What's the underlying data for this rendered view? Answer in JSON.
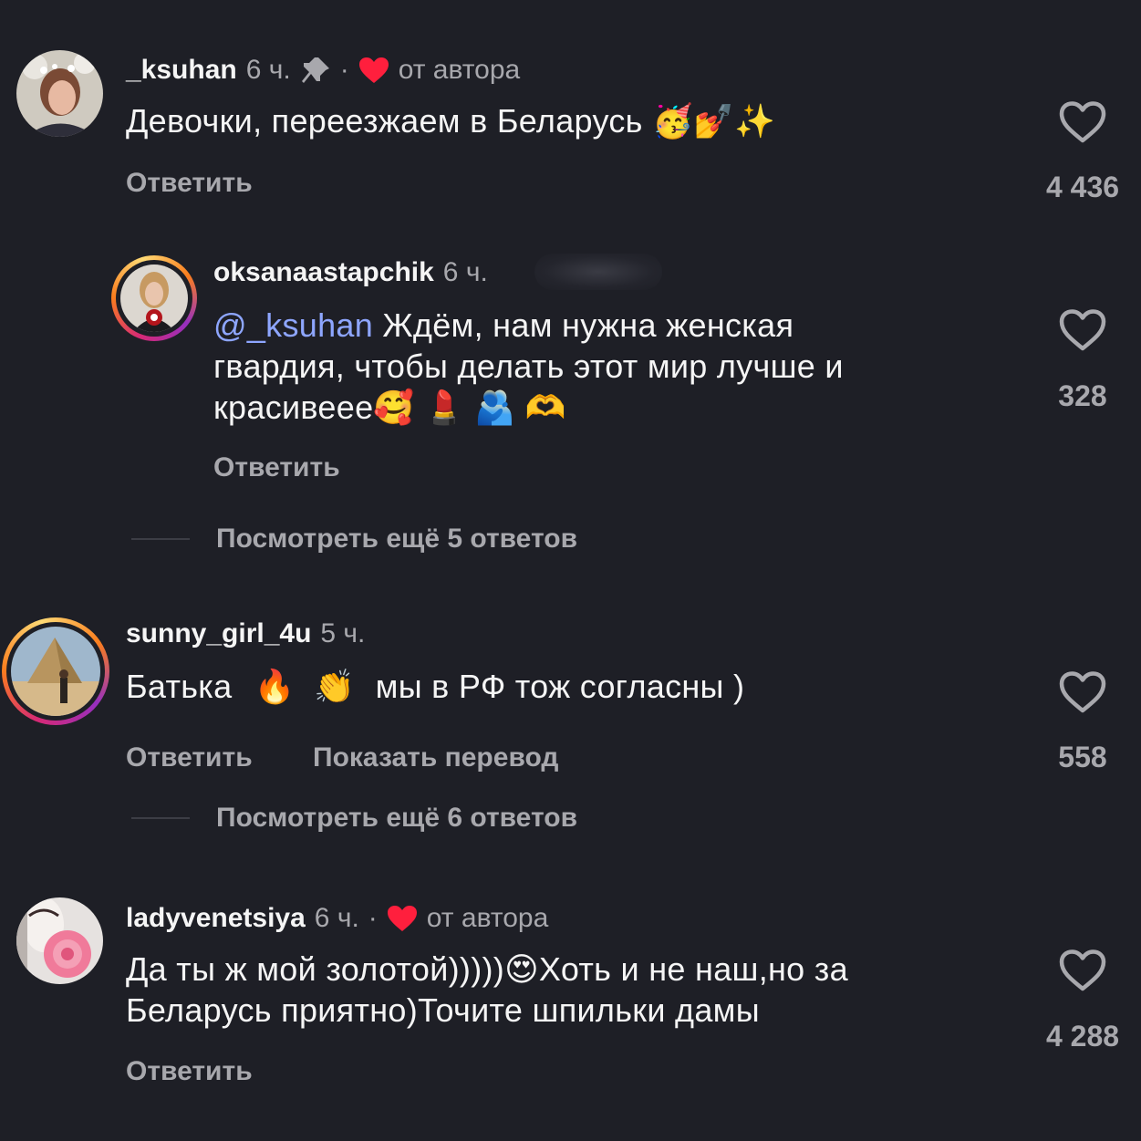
{
  "comments": [
    {
      "username": "_ksuhan",
      "time": "6 ч.",
      "dot": "·",
      "by_author": "от автора",
      "text": "Девочки, переезжаем в Беларусь",
      "emojis": "🥳💅✨",
      "reply": "Ответить",
      "likes": "4 436"
    },
    {
      "username": "oksanaastapchik",
      "time": "6 ч.",
      "mention": "@_ksuhan",
      "text_line1": " Ждём, нам нужна женская",
      "text_line2": "гвардия, чтобы делать этот мир лучше и",
      "text_line3": "красивеее",
      "emojis": "🥰 💄 🫂 🫶",
      "reply": "Ответить",
      "likes": "328",
      "more_replies": "Посмотреть ещё 5 ответов"
    },
    {
      "username": "sunny_girl_4u",
      "time": "5 ч.",
      "text_a": "Батька",
      "emoji_a": "🔥",
      "emoji_b": "👏",
      "text_b": "мы в РФ тож согласны )",
      "reply": "Ответить",
      "translate": "Показать перевод",
      "likes": "558",
      "more_replies": "Посмотреть ещё 6 ответов"
    },
    {
      "username": "ladyvenetsiya",
      "time": "6 ч.",
      "dot": "·",
      "by_author": "от автора",
      "text_line1": "Да ты ж мой золотой)))))",
      "emoji": "😍",
      "text_line1b": "Хоть и не наш,но за",
      "text_line2": "Беларусь приятно)Точите шпильки дамы",
      "reply": "Ответить",
      "likes": "4 288"
    }
  ],
  "icons": {
    "like": "heart-outline-icon",
    "author_like": "heart-filled-icon",
    "pin": "pin-icon"
  },
  "colors": {
    "background": "#1e1f26",
    "secondary_text": "#a8a8ad",
    "mention": "#8ea6ff",
    "author_heart": "#ff1f3d"
  }
}
